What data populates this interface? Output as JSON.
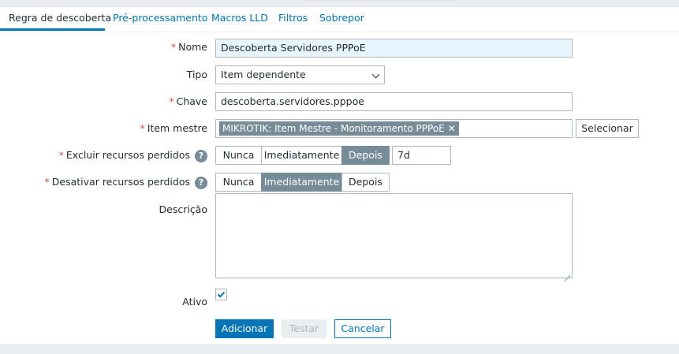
{
  "tabs": [
    {
      "label": "Regra de descoberta",
      "active": true
    },
    {
      "label": "Pré-processamento",
      "active": false
    },
    {
      "label": "Macros LLD",
      "active": false
    },
    {
      "label": "Filtros",
      "active": false
    },
    {
      "label": "Sobrepor",
      "active": false
    }
  ],
  "form": {
    "required_marker": "*",
    "name": {
      "label": "Nome",
      "value": "Descoberta Servidores PPPoE"
    },
    "type": {
      "label": "Tipo",
      "value": "Item dependente"
    },
    "key": {
      "label": "Chave",
      "value": "descoberta.servidores.pppoe"
    },
    "master_item": {
      "label": "Item mestre",
      "chip": "MIKROTIK: Item Mestre - Monitoramento PPPoE",
      "remove": "✕",
      "select_button": "Selecionar"
    },
    "delete_lost": {
      "label": "Excluir recursos perdidos",
      "help": "?",
      "options": [
        "Nunca",
        "Imediatamente",
        "Depois"
      ],
      "selected": "Depois",
      "period": "7d"
    },
    "disable_lost": {
      "label": "Desativar recursos perdidos",
      "help": "?",
      "options": [
        "Nunca",
        "Imediatamente",
        "Depois"
      ],
      "selected": "Imediatamente"
    },
    "description": {
      "label": "Descrição",
      "value": ""
    },
    "enabled": {
      "label": "Ativo",
      "checked": true
    }
  },
  "buttons": {
    "add": "Adicionar",
    "test": "Testar",
    "cancel": "Cancelar"
  },
  "colors": {
    "accent": "#0275b8",
    "required": "#d64e4e",
    "selected_segment": "#768d99"
  }
}
